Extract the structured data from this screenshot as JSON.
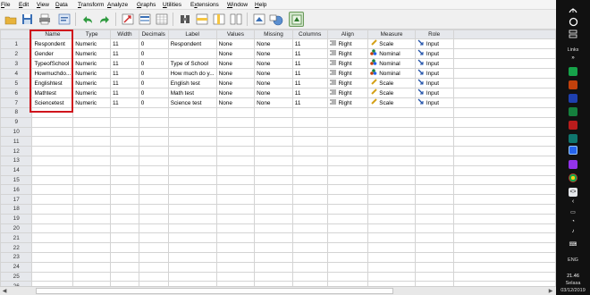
{
  "menu": [
    "File",
    "Edit",
    "View",
    "Data",
    "Transform",
    "Analyze",
    "Graphs",
    "Utilities",
    "Extensions",
    "Window",
    "Help"
  ],
  "menu_underline": [
    "F",
    "E",
    "V",
    "D",
    "T",
    "A",
    "G",
    "U",
    "x",
    "W",
    "H"
  ],
  "columns": [
    "Name",
    "Type",
    "Width",
    "Decimals",
    "Label",
    "Values",
    "Missing",
    "Columns",
    "Align",
    "Measure",
    "Role"
  ],
  "rows": [
    {
      "num": "1",
      "name": "Respondent",
      "type": "Numeric",
      "width": "11",
      "decimals": "0",
      "label": "Respondent",
      "values": "None",
      "missing": "None",
      "columns": "11",
      "align": "Right",
      "measure": "Scale",
      "measure_icon": "ruler-icon",
      "role": "Input"
    },
    {
      "num": "2",
      "name": "Gender",
      "type": "Numeric",
      "width": "11",
      "decimals": "0",
      "label": "",
      "values": "None",
      "missing": "None",
      "columns": "11",
      "align": "Right",
      "measure": "Nominal",
      "measure_icon": "nominal-icon",
      "role": "Input"
    },
    {
      "num": "3",
      "name": "TypeofSchool",
      "type": "Numeric",
      "width": "11",
      "decimals": "0",
      "label": "Type of School",
      "values": "None",
      "missing": "None",
      "columns": "11",
      "align": "Right",
      "measure": "Nominal",
      "measure_icon": "nominal-icon",
      "role": "Input"
    },
    {
      "num": "4",
      "name": "Howmuchdo...",
      "type": "Numeric",
      "width": "11",
      "decimals": "0",
      "label": "How much do y...",
      "values": "None",
      "missing": "None",
      "columns": "11",
      "align": "Right",
      "measure": "Nominal",
      "measure_icon": "nominal-icon",
      "role": "Input"
    },
    {
      "num": "5",
      "name": "Englishtest",
      "type": "Numeric",
      "width": "11",
      "decimals": "0",
      "label": "English test",
      "values": "None",
      "missing": "None",
      "columns": "11",
      "align": "Right",
      "measure": "Scale",
      "measure_icon": "ruler-icon",
      "role": "Input"
    },
    {
      "num": "6",
      "name": "Mathtest",
      "type": "Numeric",
      "width": "11",
      "decimals": "0",
      "label": "Math test",
      "values": "None",
      "missing": "None",
      "columns": "11",
      "align": "Right",
      "measure": "Scale",
      "measure_icon": "ruler-icon",
      "role": "Input"
    },
    {
      "num": "7",
      "name": "Sciencetest",
      "type": "Numeric",
      "width": "11",
      "decimals": "0",
      "label": "Science test",
      "values": "None",
      "missing": "None",
      "columns": "11",
      "align": "Right",
      "measure": "Scale",
      "measure_icon": "ruler-icon",
      "role": "Input"
    }
  ],
  "empty_rows": [
    "8",
    "9",
    "10",
    "11",
    "12",
    "13",
    "14",
    "15",
    "16",
    "17",
    "18",
    "19",
    "20",
    "21",
    "22",
    "23",
    "24",
    "25",
    "26"
  ],
  "colors": {
    "highlight": "#d0141c",
    "header_bg": "#e6e8ec",
    "taskbar_bg": "#111111"
  },
  "taskbar": {
    "links_label": "Links",
    "time": "21.46",
    "day": "Selasa",
    "date": "03/12/2019",
    "language": "ENG"
  }
}
